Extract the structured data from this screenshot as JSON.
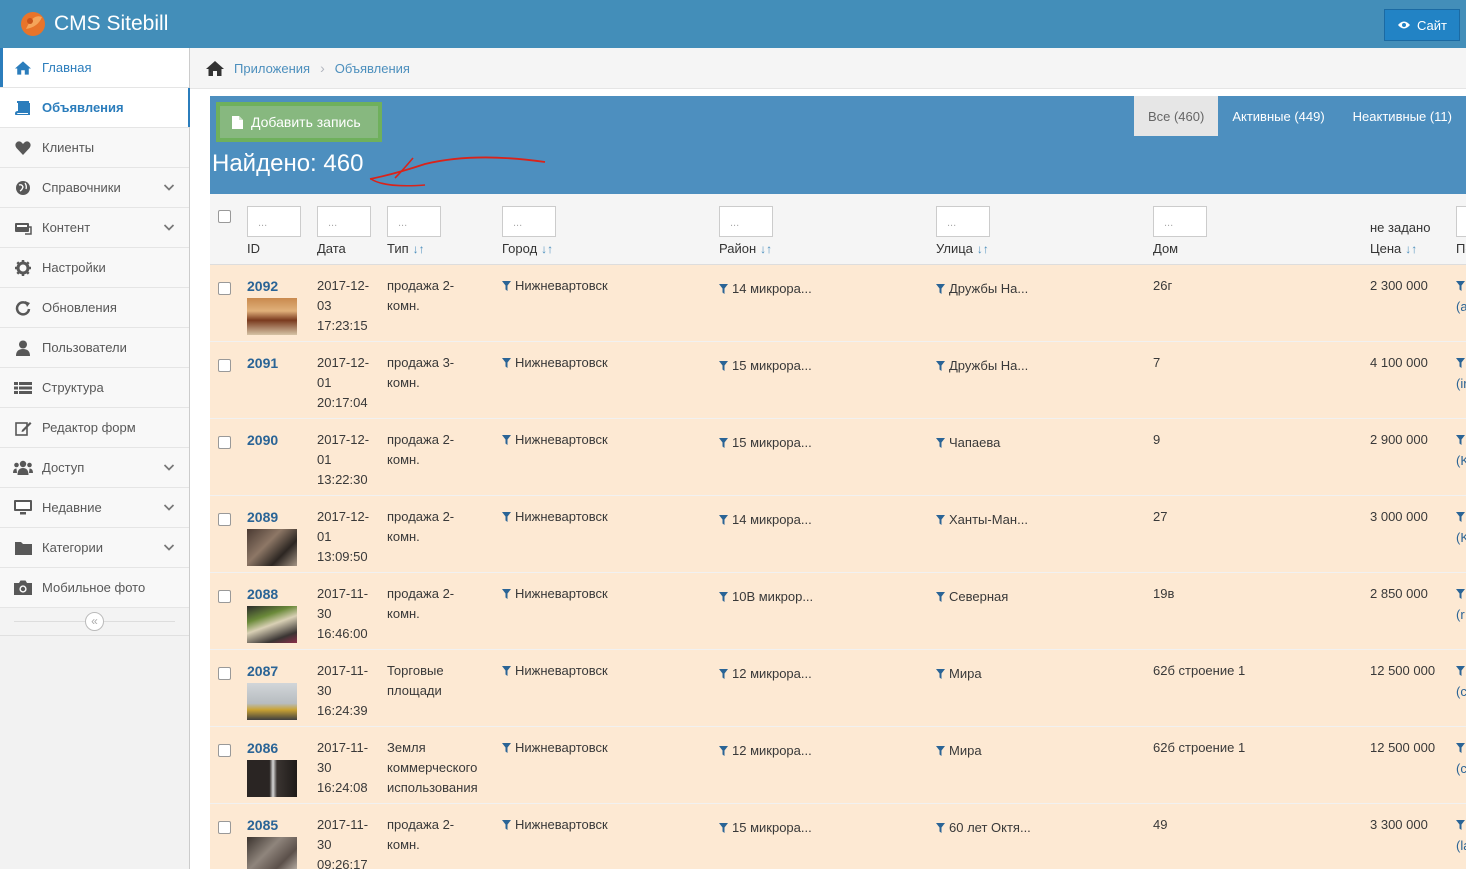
{
  "app": {
    "title": "CMS Sitebill",
    "site_button": "Сайт"
  },
  "sidebar": {
    "items": [
      {
        "label": "Главная",
        "icon": "home-icon",
        "state": "active"
      },
      {
        "label": "Объявления",
        "icon": "book-icon",
        "state": "current"
      },
      {
        "label": "Клиенты",
        "icon": "heart-icon"
      },
      {
        "label": "Справочники",
        "icon": "globe-icon",
        "arrow": true
      },
      {
        "label": "Контент",
        "icon": "keyboard-icon",
        "arrow": true
      },
      {
        "label": "Настройки",
        "icon": "gear-icon"
      },
      {
        "label": "Обновления",
        "icon": "refresh-icon"
      },
      {
        "label": "Пользователи",
        "icon": "user-icon"
      },
      {
        "label": "Структура",
        "icon": "list-icon"
      },
      {
        "label": "Редактор форм",
        "icon": "edit-icon"
      },
      {
        "label": "Доступ",
        "icon": "users-icon",
        "arrow": true
      },
      {
        "label": "Недавние",
        "icon": "monitor-icon",
        "arrow": true
      },
      {
        "label": "Категории",
        "icon": "folder-icon",
        "arrow": true
      },
      {
        "label": "Мобильное фото",
        "icon": "camera-icon"
      }
    ],
    "collapse_glyph": "«"
  },
  "breadcrumbs": {
    "items": [
      "Приложения",
      "Объявления"
    ],
    "separator": "›"
  },
  "toolbar": {
    "add_label": "Добавить запись",
    "tabs": [
      "Все (460)",
      "Активные (449)",
      "Неактивные (11)"
    ],
    "found": "Найдено: 460"
  },
  "table": {
    "filter_placeholder": "...",
    "headers": {
      "id": "ID",
      "date": "Дата",
      "type": "Тип",
      "city": "Город",
      "district": "Район",
      "street": "Улица",
      "house": "Дом",
      "price_top": "не задано",
      "price": "Цена",
      "last": "По"
    },
    "sort_arrows": "↓↑",
    "rows": [
      {
        "id": "2092",
        "date": [
          "2017-12-",
          "03",
          "17:23:15"
        ],
        "type": [
          "продажа 2-",
          "комн."
        ],
        "city": "Нижневартовск",
        "district": "14 микрора...",
        "street": "Дружбы На...",
        "house": "26г",
        "price": "2 300 000",
        "last": "(a",
        "thumb": "t1"
      },
      {
        "id": "2091",
        "date": [
          "2017-12-",
          "01",
          "20:17:04"
        ],
        "type": [
          "продажа 3-",
          "комн."
        ],
        "city": "Нижневартовск",
        "district": "15 микрора...",
        "street": "Дружбы На...",
        "house": "7",
        "price": "4 100 000",
        "last": "(ir",
        "thumb": ""
      },
      {
        "id": "2090",
        "date": [
          "2017-12-",
          "01",
          "13:22:30"
        ],
        "type": [
          "продажа 2-",
          "комн."
        ],
        "city": "Нижневартовск",
        "district": "15 микрора...",
        "street": "Чапаева",
        "house": "9",
        "price": "2 900 000",
        "last": "(K",
        "thumb": ""
      },
      {
        "id": "2089",
        "date": [
          "2017-12-",
          "01",
          "13:09:50"
        ],
        "type": [
          "продажа 2-",
          "комн."
        ],
        "city": "Нижневартовск",
        "district": "14 микрора...",
        "street": "Ханты-Ман...",
        "house": "27",
        "price": "3 000 000",
        "last": "(K",
        "thumb": "t2"
      },
      {
        "id": "2088",
        "date": [
          "2017-11-",
          "30",
          "16:46:00"
        ],
        "type": [
          "продажа 2-",
          "комн."
        ],
        "city": "Нижневартовск",
        "district": "10В микрор...",
        "street": "Северная",
        "house": "19в",
        "price": "2 850 000",
        "last": "(r",
        "thumb": "t3"
      },
      {
        "id": "2087",
        "date": [
          "2017-11-",
          "30",
          "16:24:39"
        ],
        "type": [
          "Торговые",
          "площади"
        ],
        "city": "Нижневартовск",
        "district": "12 микрора...",
        "street": "Мира",
        "house": "62б строение 1",
        "price": "12 500 000",
        "last": "(c",
        "thumb": "t4"
      },
      {
        "id": "2086",
        "date": [
          "2017-11-",
          "30",
          "16:24:08"
        ],
        "type": [
          "Земля",
          "коммерческого",
          "использования"
        ],
        "city": "Нижневартовск",
        "district": "12 микрора...",
        "street": "Мира",
        "house": "62б строение 1",
        "price": "12 500 000",
        "last": "(c",
        "thumb": "t5"
      },
      {
        "id": "2085",
        "date": [
          "2017-11-",
          "30",
          "09:26:17"
        ],
        "type": [
          "продажа 2-",
          "комн."
        ],
        "city": "Нижневартовск",
        "district": "15 микрора...",
        "street": "60 лет Октя...",
        "house": "49",
        "price": "3 300 000",
        "last": "(la",
        "thumb": "t6"
      }
    ]
  }
}
